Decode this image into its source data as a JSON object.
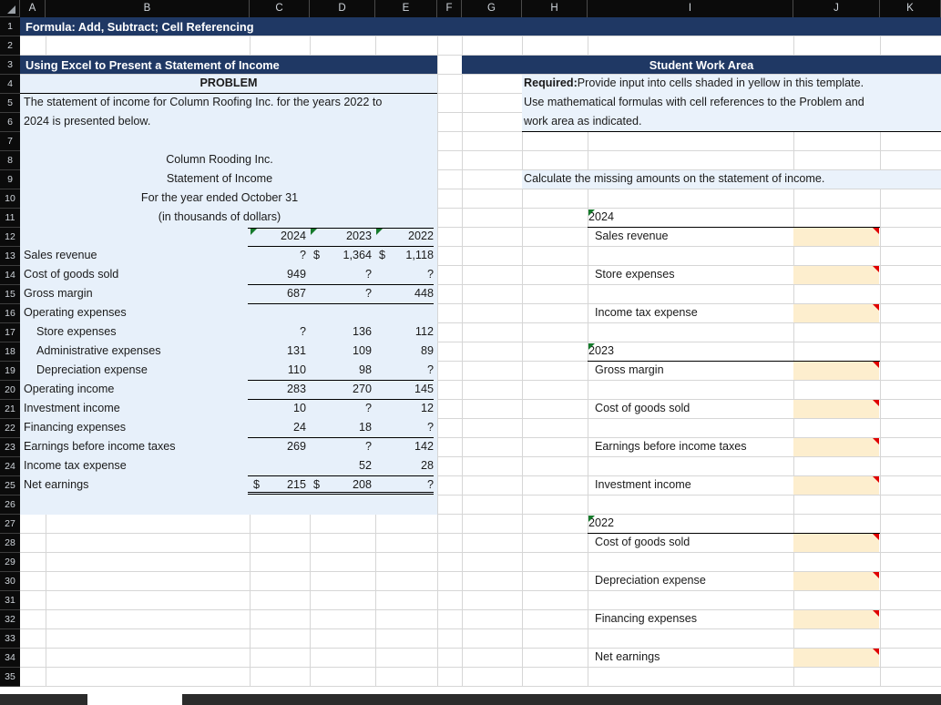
{
  "workbook": {
    "column_headers": [
      "A",
      "B",
      "C",
      "D",
      "E",
      "F",
      "G",
      "H",
      "I",
      "J",
      "K"
    ],
    "row_headers": [
      "1",
      "2",
      "3",
      "4",
      "5",
      "6",
      "7",
      "8",
      "9",
      "10",
      "11",
      "12",
      "13",
      "14",
      "15",
      "16",
      "17",
      "18",
      "19",
      "20",
      "21",
      "22",
      "23",
      "24",
      "25",
      "26",
      "27",
      "28",
      "29",
      "30",
      "31",
      "32",
      "33",
      "34",
      "35"
    ],
    "colors": {
      "banner": "#1F3864",
      "problem_shade": "#E7F0FA",
      "input_yellow": "#FDEECE",
      "comment_red": "#E00000",
      "comment_green": "#157A2B"
    }
  },
  "titles": {
    "row1_banner": "Formula: Add, Subtract; Cell Referencing",
    "problem_banner": "Using Excel to Present a Statement of Income",
    "problem_label": "PROBLEM",
    "work_area_banner": "Student Work Area"
  },
  "problem": {
    "intro_line1": "The statement of income for Column Roofing Inc. for the years 2022 to",
    "intro_line2": "2024 is presented below.",
    "company": "Column Rooding Inc.",
    "statement": "Statement of Income",
    "period": "For the year ended October 31",
    "units": "(in thousands of dollars)",
    "year_headers": [
      "2024",
      "2023",
      "2022"
    ],
    "rows": [
      {
        "label": "Sales revenue",
        "indent": 0,
        "y2024": "?",
        "d2024": "",
        "y2023": "1,364",
        "d2023": "$",
        "y2022": "1,118",
        "d2022": "$"
      },
      {
        "label": "Cost of goods sold",
        "indent": 0,
        "y2024": "949",
        "d2024": "",
        "y2023": "?",
        "d2023": "",
        "y2022": "?",
        "d2022": ""
      },
      {
        "label": "Gross margin",
        "indent": 0,
        "y2024": "687",
        "d2024": "",
        "y2023": "?",
        "d2023": "",
        "y2022": "448",
        "d2022": ""
      },
      {
        "label": "Operating expenses",
        "indent": 0,
        "y2024": "",
        "d2024": "",
        "y2023": "",
        "d2023": "",
        "y2022": "",
        "d2022": ""
      },
      {
        "label": "Store expenses",
        "indent": 1,
        "y2024": "?",
        "d2024": "",
        "y2023": "136",
        "d2023": "",
        "y2022": "112",
        "d2022": ""
      },
      {
        "label": "Administrative expenses",
        "indent": 1,
        "y2024": "131",
        "d2024": "",
        "y2023": "109",
        "d2023": "",
        "y2022": "89",
        "d2022": ""
      },
      {
        "label": "Depreciation expense",
        "indent": 1,
        "y2024": "110",
        "d2024": "",
        "y2023": "98",
        "d2023": "",
        "y2022": "?",
        "d2022": ""
      },
      {
        "label": "Operating income",
        "indent": 0,
        "y2024": "283",
        "d2024": "",
        "y2023": "270",
        "d2023": "",
        "y2022": "145",
        "d2022": ""
      },
      {
        "label": "Investment income",
        "indent": 0,
        "y2024": "10",
        "d2024": "",
        "y2023": "?",
        "d2023": "",
        "y2022": "12",
        "d2022": ""
      },
      {
        "label": "Financing expenses",
        "indent": 0,
        "y2024": "24",
        "d2024": "",
        "y2023": "18",
        "d2023": "",
        "y2022": "?",
        "d2022": ""
      },
      {
        "label": "Earnings before income taxes",
        "indent": 0,
        "y2024": "269",
        "d2024": "",
        "y2023": "?",
        "d2023": "",
        "y2022": "142",
        "d2022": ""
      },
      {
        "label": "Income tax expense",
        "indent": 0,
        "y2024": "",
        "d2024": "",
        "y2023": "52",
        "d2023": "",
        "y2022": "28",
        "d2022": ""
      },
      {
        "label": "Net earnings",
        "indent": 0,
        "y2024": "215",
        "d2024": "$",
        "y2023": "208",
        "d2023": "$",
        "y2022": "?",
        "d2022": ""
      }
    ]
  },
  "work_area": {
    "required_label": "Required:",
    "required_text": " Provide input into cells shaded in yellow in this template.",
    "required_line2": "Use mathematical formulas with cell references to the Problem and",
    "required_line3": "work area as indicated.",
    "instruction": "Calculate the missing amounts on the statement of income.",
    "groups": [
      {
        "year": "2024",
        "items": [
          "Sales revenue",
          "Store expenses",
          "Income tax expense"
        ]
      },
      {
        "year": "2023",
        "items": [
          "Gross margin",
          "Cost of goods sold",
          "Earnings before income taxes",
          "Investment income"
        ]
      },
      {
        "year": "2022",
        "items": [
          "Cost of goods sold",
          "Depreciation expense",
          "Financing expenses",
          "Net earnings"
        ]
      }
    ]
  }
}
